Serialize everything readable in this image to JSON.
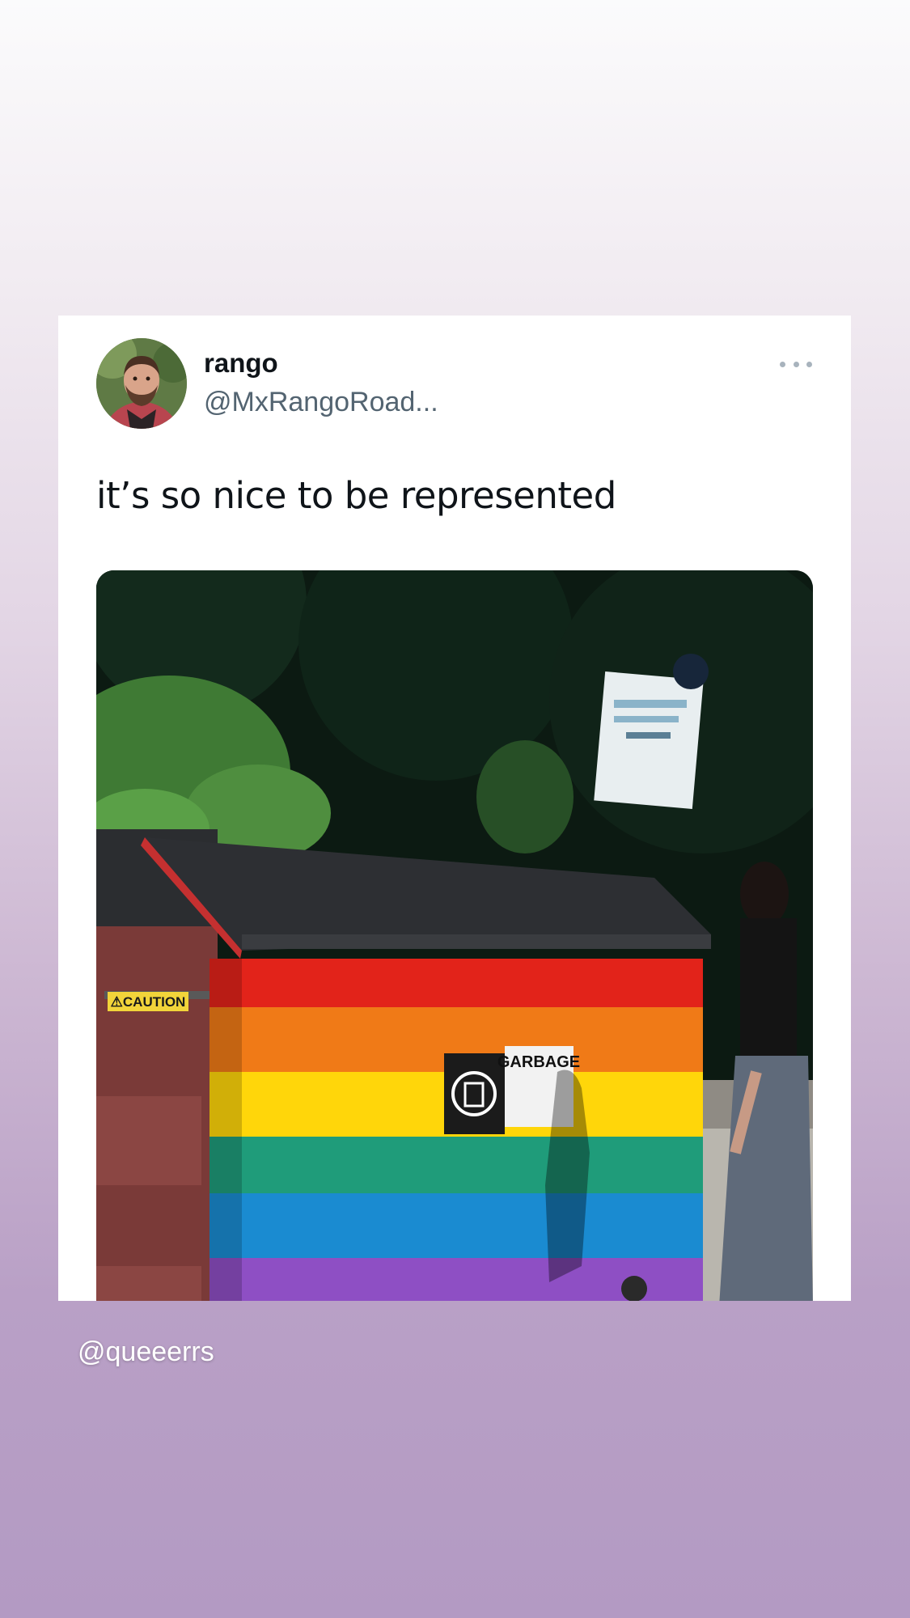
{
  "tweet": {
    "display_name": "rango",
    "handle": "@MxRangoRoad...",
    "text": "it’s so nice to be represented",
    "more_icon": "more-dots-icon",
    "photo": {
      "caution_label": "⚠CAUTION",
      "garbage_label": "GARBAGE",
      "garbage_icon": "trash-can-icon"
    }
  },
  "story": {
    "credit": "@queeerrs"
  },
  "colors": {
    "handle_gray": "#536471",
    "text_dark": "#0f1419",
    "background_top": "#fbfbfc",
    "background_bottom": "#b39ac3"
  }
}
